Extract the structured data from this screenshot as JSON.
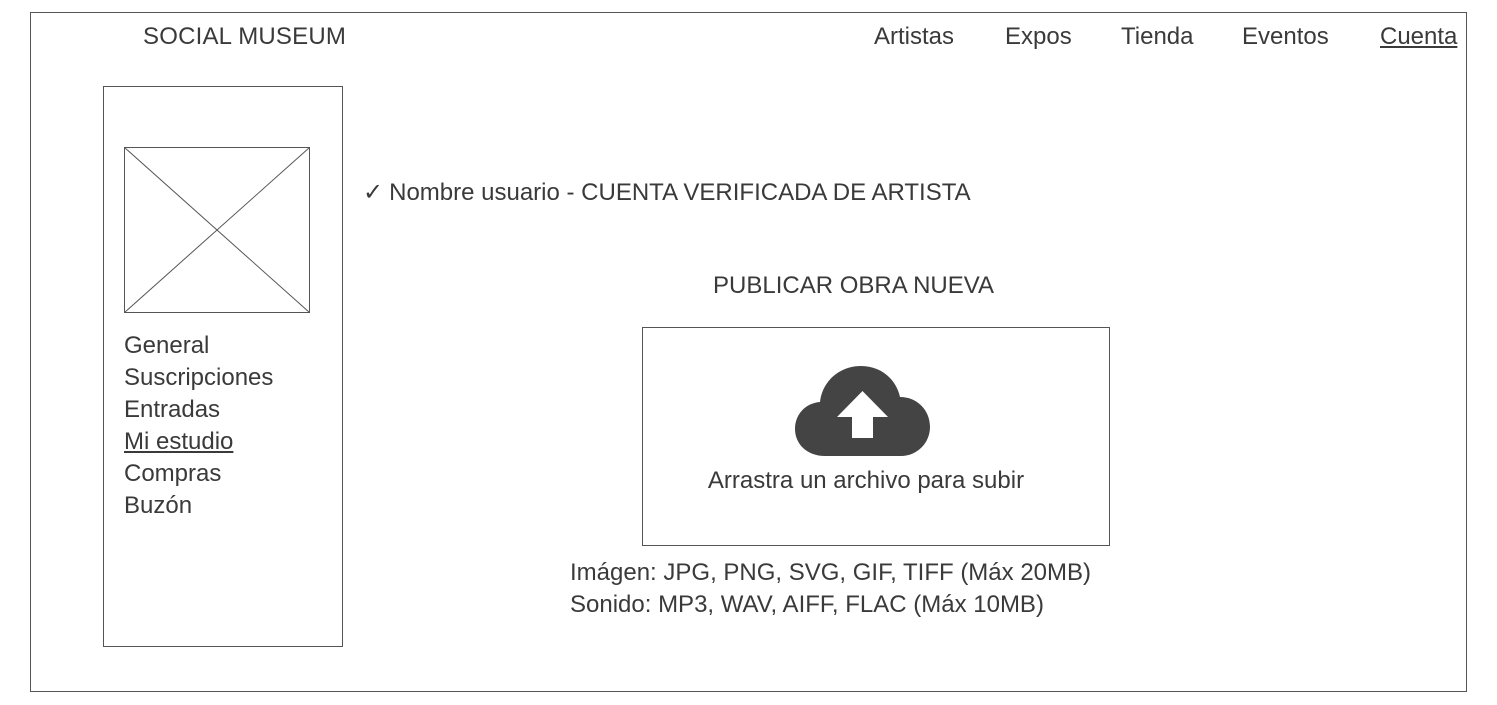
{
  "header": {
    "brand": "SOCIAL MUSEUM",
    "nav": {
      "artistas": "Artistas",
      "expos": "Expos",
      "tienda": "Tienda",
      "eventos": "Eventos",
      "cuenta": "Cuenta"
    },
    "active_nav": "Cuenta"
  },
  "sidebar": {
    "avatar_icon": "image-placeholder-icon",
    "items": [
      "General",
      "Suscripciones",
      "Entradas",
      "Mi estudio",
      "Compras",
      "Buzón"
    ],
    "active_item": "Mi estudio"
  },
  "main": {
    "check_icon": "✓",
    "verified_text": "Nombre usuario - CUENTA VERIFICADA DE ARTISTA",
    "title": "PUBLICAR OBRA NUEVA",
    "dropzone": {
      "icon": "cloud-upload-icon",
      "label": "Arrastra un archivo para subir"
    },
    "formats": {
      "image": "Imágen: JPG, PNG, SVG, GIF, TIFF (Máx 20MB)",
      "sound": "Sonido: MP3, WAV, AIFF, FLAC (Máx 10MB)"
    }
  },
  "colors": {
    "text": "#3a3a3a",
    "border": "#555555",
    "icon": "#444444"
  }
}
